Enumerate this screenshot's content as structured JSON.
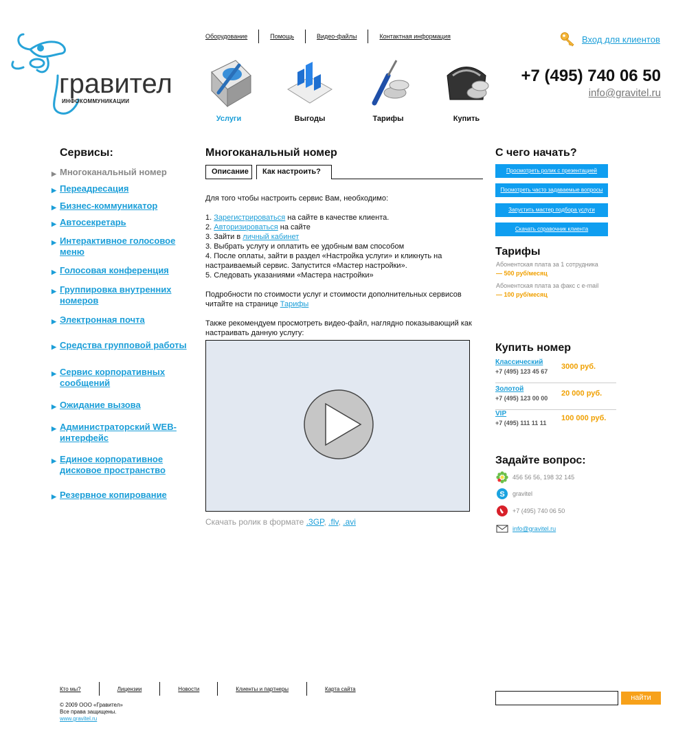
{
  "header": {
    "logo_word": "гравител",
    "logo_sub": "ИНФОКОММУНИКАЦИИ",
    "top_nav": [
      "Оборудование",
      "Помощь",
      "Видео-файлы",
      "Контактная информация"
    ],
    "login_label": "Вход для клиентов",
    "phone": "+7 (495) 740 06 50",
    "email": "info@gravitel.ru",
    "icons": [
      {
        "label": "Услуги",
        "icon": "book-icon",
        "color": "#1b9ed8"
      },
      {
        "label": "Выгоды",
        "icon": "bar-chart-icon",
        "color": "#111111"
      },
      {
        "label": "Тарифы",
        "icon": "tools-coins-icon",
        "color": "#111111"
      },
      {
        "label": "Купить",
        "icon": "wallet-icon",
        "color": "#111111"
      }
    ]
  },
  "sidebar": {
    "title": "Сервисы:",
    "items": [
      "Многоканальный номер",
      "Переадресация",
      "Бизнес-коммуникатор",
      "Автосекретарь",
      "Интерактивное голосовое меню",
      "Голосовая конференция",
      "Группировка внутренних номеров",
      "Электронная почта",
      "Средства групповой работы",
      "Сервис корпоративных сообщений",
      "Ожидание вызова",
      "Администраторский WEB-интерфейс",
      "Единое корпоративное дисковое пространство",
      "Резервное копирование"
    ],
    "active_index": 0
  },
  "main": {
    "title": "Многоканальный номер",
    "tabs": [
      "Описание",
      "Как настроить?"
    ],
    "intro": "Для того чтобы настроить сервис Вам, необходимо:",
    "steps": [
      {
        "prefix": "1. ",
        "link": "Зарегистрироваться",
        "suffix": " на сайте в качестве клиента."
      },
      {
        "prefix": "2. ",
        "link": "Авторизироваться",
        "suffix": " на сайте"
      },
      {
        "prefix": "3. Зайти в ",
        "link": "личный кабинет",
        "suffix": ""
      },
      {
        "prefix": "3. Выбрать услугу и оплатить ее удобным вам способом",
        "link": "",
        "suffix": ""
      },
      {
        "prefix": "4. После оплаты, зайти в раздел «Настройка услуги» и кликнуть на настраиваемый сервис. Запустится «Мастер настройки».",
        "link": "",
        "suffix": ""
      },
      {
        "prefix": "5. Следовать указаниями «Мастера настройки»",
        "link": "",
        "suffix": ""
      }
    ],
    "pricing_text": "Подробности по стоимости услуг и стоимости дополнительных сервисов читайте на странице ",
    "pricing_link": "Тарифы",
    "video_text": "Также рекомендуем просмотреть видео-файл, наглядно показывающий как настраивать данную услугу:",
    "download_text": "Скачать ролик в формате",
    "formats": [
      ".3GP",
      ".flv",
      ".avi"
    ]
  },
  "right": {
    "start_title": "С чего начать?",
    "buttons": [
      "Просмотреть ролик с презентацией",
      "Посмотреть часто задаваемые вопросы",
      "Запустить мастер подбора услуги",
      "Скачать справочник клиента"
    ],
    "tariffs_title": "Тарифы",
    "tariffs": [
      {
        "text": "Абонентская плата за 1 сотрудника",
        "value": "— 500 руб/месяц"
      },
      {
        "text": "Абонентская плата за факс с e-mail",
        "value": "— 100 руб/месяц"
      }
    ],
    "buy_title": "Купить номер",
    "numbers": [
      {
        "name": "Классический",
        "phone": "+7 (495) 123 45 67",
        "price": "3000 руб."
      },
      {
        "name": "Золотой",
        "phone": "+7 (495) 123 00 00",
        "price": "20 000 руб."
      },
      {
        "name": "VIP",
        "phone": "+7 (495) 111 11 11",
        "price": "100 000 руб."
      }
    ],
    "ask_title": "Задайте вопрос:",
    "contacts": [
      {
        "icon": "icq-icon",
        "text": "456 56 56, 198 32 145"
      },
      {
        "icon": "skype-icon",
        "text": "gravitel"
      },
      {
        "icon": "phone-icon",
        "text": "+7 (495) 740 06 50"
      },
      {
        "icon": "mail-icon",
        "text": "info@gravitel.ru"
      }
    ]
  },
  "footer": {
    "nav": [
      "Кто мы?",
      "Лицензии",
      "Новости",
      "Клиенты и партнеры",
      "Карта сайта"
    ],
    "copyright": "© 2009 ООО «Гравител»",
    "rights": "Все права защищены.",
    "site": "www.gravitel.ru",
    "search_value": "",
    "search_button": "найти"
  }
}
